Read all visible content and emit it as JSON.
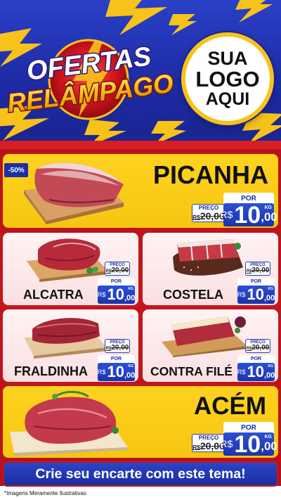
{
  "header": {
    "title_line1": "OFERTAS",
    "title_line2": "RELÂMPAGO",
    "logo_text": [
      "SUA",
      "LOGO",
      "AQUI"
    ]
  },
  "featured": {
    "discount_badge": "-50%",
    "name": "PICANHA",
    "old_label": "PREÇO",
    "old_price": "20,00",
    "old_currency": "R$",
    "por_label": "POR",
    "currency": "R$",
    "price_int": "10",
    "price_cents": ",00",
    "unit": "KG"
  },
  "products": [
    {
      "name": "ALCATRA",
      "old_label": "PREÇO",
      "old_currency": "R$",
      "old_price": "20,00",
      "por_label": "POR",
      "currency": "R$",
      "price_int": "10",
      "price_cents": ",00",
      "unit": "KG"
    },
    {
      "name": "COSTELA",
      "old_label": "PREÇO",
      "old_currency": "R$",
      "old_price": "20,00",
      "por_label": "POR",
      "currency": "R$",
      "price_int": "10",
      "price_cents": ",00",
      "unit": "KG"
    },
    {
      "name": "FRALDINHA",
      "old_label": "PREÇO",
      "old_currency": "R$",
      "old_price": "20,00",
      "por_label": "POR",
      "currency": "R$",
      "price_int": "10",
      "price_cents": ",00",
      "unit": "KG"
    },
    {
      "name": "CONTRA FILÉ",
      "old_label": "PREÇO",
      "old_currency": "R$",
      "old_price": "20,00",
      "por_label": "POR",
      "currency": "R$",
      "price_int": "10",
      "price_cents": ",00",
      "unit": "KG"
    }
  ],
  "bottom_featured": {
    "name": "ACÉM",
    "old_label": "PREÇO",
    "old_currency": "R$",
    "old_price": "20,00",
    "por_label": "POR",
    "currency": "R$",
    "price_int": "10",
    "price_cents": ",00",
    "unit": "KG"
  },
  "cta": {
    "label": "Crie seu encarte com este tema!"
  },
  "footnote": "*Imagens Meramente Ilustrativas",
  "colors": {
    "header_blue": "#1d2aa4",
    "bolt_yellow": "#f7c21a",
    "body_red": "#c4161d",
    "card_yellow": "#ffd21f",
    "card_pink": "#fadfe2",
    "price_blue": "#1b34ad"
  }
}
